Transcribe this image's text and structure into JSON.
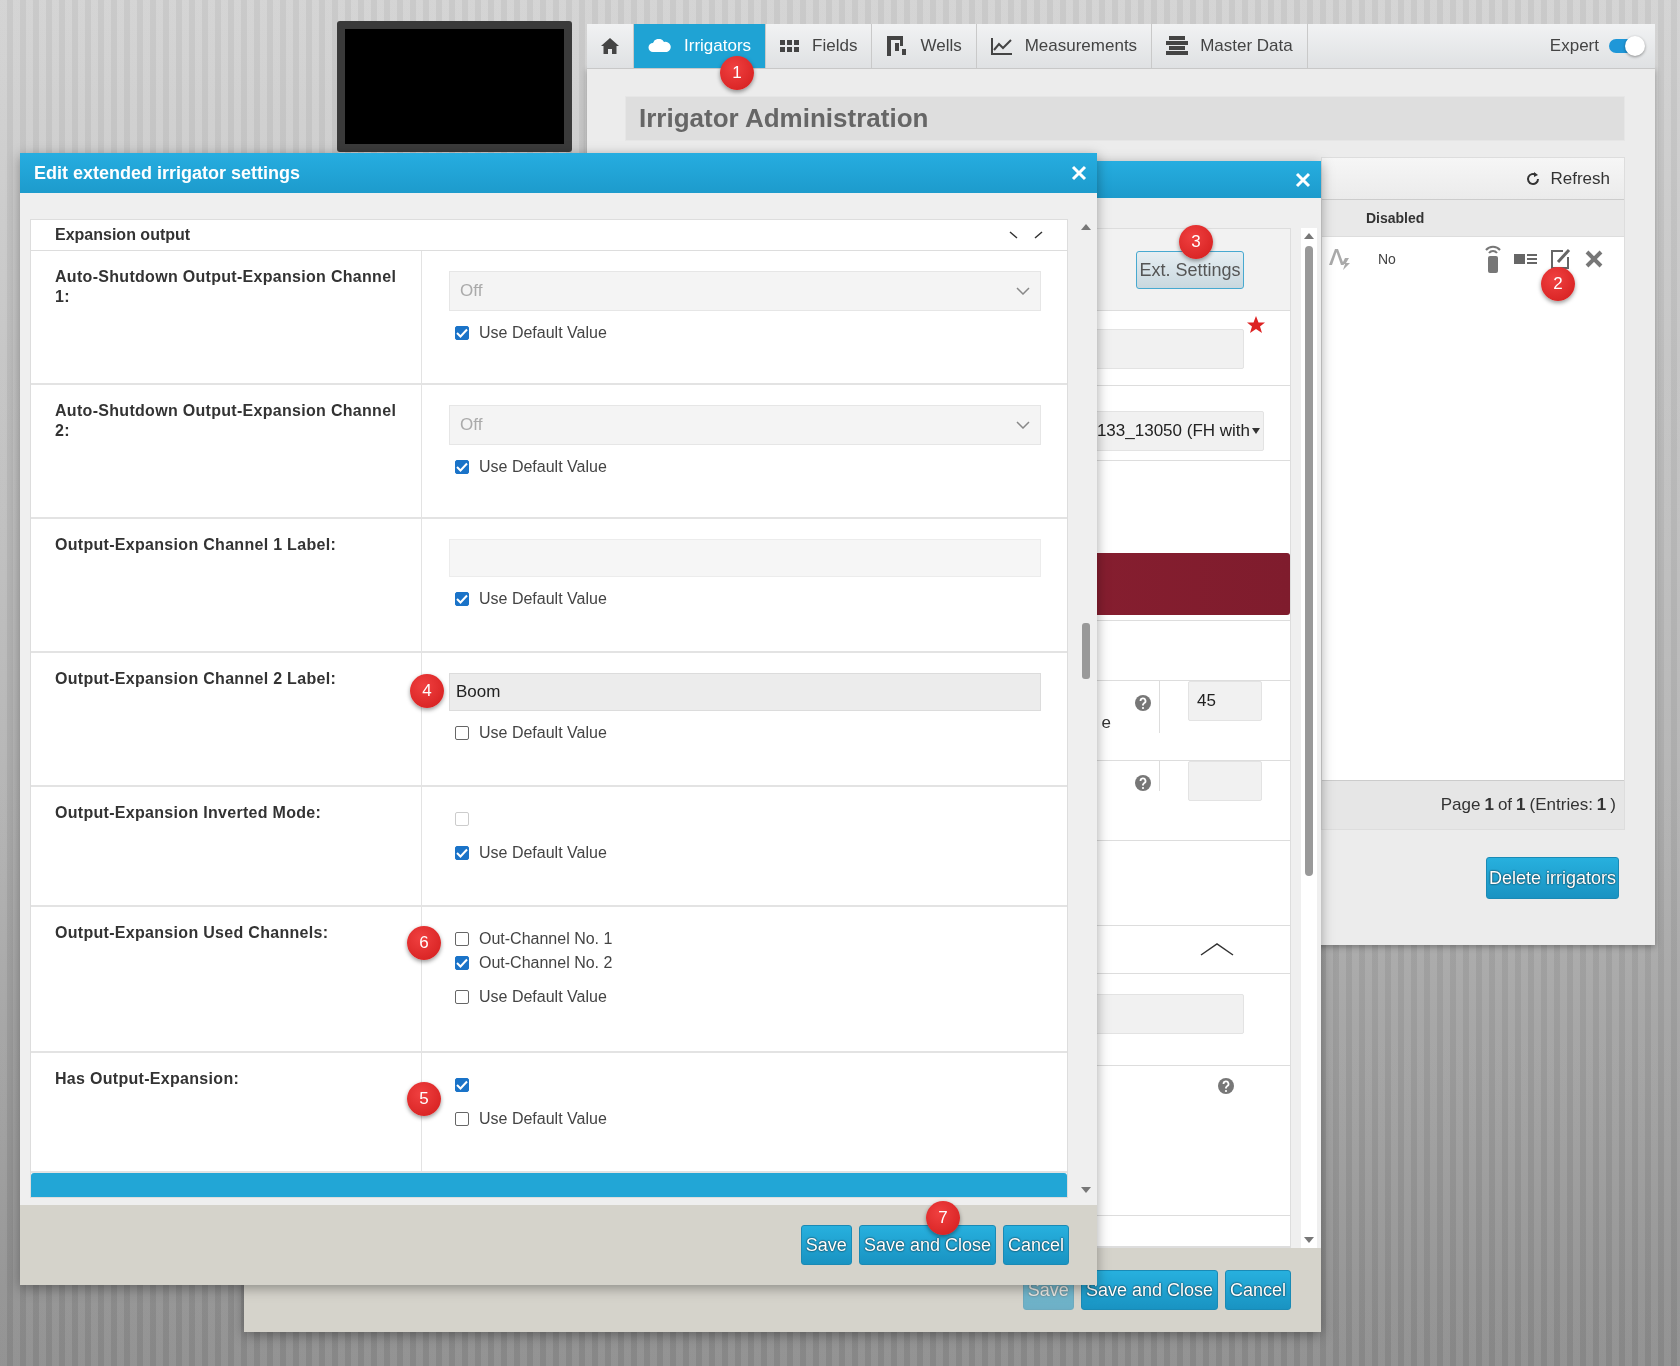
{
  "nav": {
    "tabs": [
      {
        "kind": "home",
        "selected": false
      },
      {
        "kind": "cloud",
        "label": "Irrigators",
        "selected": true
      },
      {
        "kind": "grid",
        "label": "Fields",
        "selected": false
      },
      {
        "kind": "well",
        "label": "Wells",
        "selected": false
      },
      {
        "kind": "chart",
        "label": "Measurements",
        "selected": false
      },
      {
        "kind": "stack",
        "label": "Master Data",
        "selected": false
      }
    ],
    "expert_toggle": {
      "label": "Expert",
      "on": true
    }
  },
  "page_title": "Irrigator Administration",
  "irrigator_list": {
    "refresh": "Refresh",
    "columns": [
      "Disabled"
    ],
    "rows": [
      {
        "disabled": "No"
      }
    ],
    "pager": "Page **1** of **1** (Entries: **1**)",
    "delete_button": "Delete irrigators"
  },
  "edit_dialog": {
    "ext_settings_button": "Ext. Settings",
    "device_select": "133_13050 (FH with",
    "label_fragment": "e",
    "value_field": "45",
    "buttons": [
      {
        "label": "Save",
        "disabled": true
      },
      {
        "label": "Save and Close",
        "disabled": false
      },
      {
        "label": "Cancel",
        "disabled": false
      }
    ]
  },
  "extended_dialog": {
    "title": "Edit extended irrigator settings",
    "section": "Expansion output",
    "settings": [
      {
        "kind": "select",
        "label": "Auto-Shutdown Output-Expansion Channel 1:",
        "value": "Off",
        "disabled": true,
        "use_default": {
          "label": "Use Default Value",
          "checked": true
        }
      },
      {
        "kind": "select",
        "label": "Auto-Shutdown Output-Expansion Channel 2:",
        "value": "Off",
        "disabled": true,
        "use_default": {
          "label": "Use Default Value",
          "checked": true
        }
      },
      {
        "kind": "text",
        "label": "Output-Expansion Channel 1 Label:",
        "disabled": true,
        "use_default": {
          "label": "Use Default Value",
          "checked": true
        }
      },
      {
        "kind": "text",
        "label": "Output-Expansion Channel 2 Label:",
        "value": "Boom",
        "disabled": false,
        "use_default": {
          "label": "Use Default Value",
          "checked": false
        }
      },
      {
        "kind": "checkbox",
        "label": "Output-Expansion Inverted Mode:",
        "checked": false,
        "disabled": true,
        "use_default": {
          "label": "Use Default Value",
          "checked": true
        }
      },
      {
        "kind": "checklist",
        "label": "Output-Expansion Used Channels:",
        "options": [
          {
            "label": "Out-Channel No. 1",
            "checked": false
          },
          {
            "label": "Out-Channel No. 2",
            "checked": true
          }
        ],
        "use_default": {
          "label": "Use Default Value",
          "checked": false
        }
      },
      {
        "kind": "checkbox",
        "label": "Has Output-Expansion:",
        "checked": true,
        "disabled": false,
        "use_default": {
          "label": "Use Default Value",
          "checked": false
        }
      }
    ],
    "buttons": [
      {
        "label": "Save",
        "disabled": false
      },
      {
        "label": "Save and Close",
        "disabled": false
      },
      {
        "label": "Cancel",
        "disabled": false
      }
    ]
  },
  "annotations": [
    "1",
    "2",
    "3",
    "4",
    "6",
    "5",
    "7"
  ]
}
